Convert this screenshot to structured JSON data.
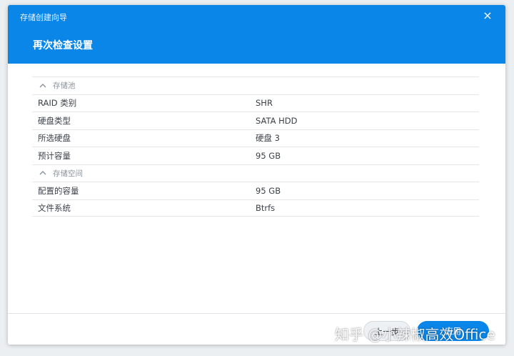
{
  "window": {
    "title": "存储创建向导",
    "close_glyph": "×"
  },
  "page": {
    "title": "再次检查设置"
  },
  "sections": [
    {
      "title": "存储池",
      "rows": [
        {
          "label": "RAID 类别",
          "value": "SHR"
        },
        {
          "label": "硬盘类型",
          "value": "SATA HDD"
        },
        {
          "label": "所选硬盘",
          "value": "硬盘 3"
        },
        {
          "label": "预计容量",
          "value": "95 GB"
        }
      ]
    },
    {
      "title": "存储空间",
      "rows": [
        {
          "label": "配置的容量",
          "value": "95 GB"
        },
        {
          "label": "文件系统",
          "value": "Btrfs"
        }
      ]
    }
  ],
  "footer": {
    "prev_label": "上一步",
    "apply_label": "应用"
  },
  "watermark": "知乎 @小辣椒高效Office",
  "colors": {
    "accent": "#0a86e8",
    "text": "#3c4149",
    "muted": "#8a929b"
  }
}
